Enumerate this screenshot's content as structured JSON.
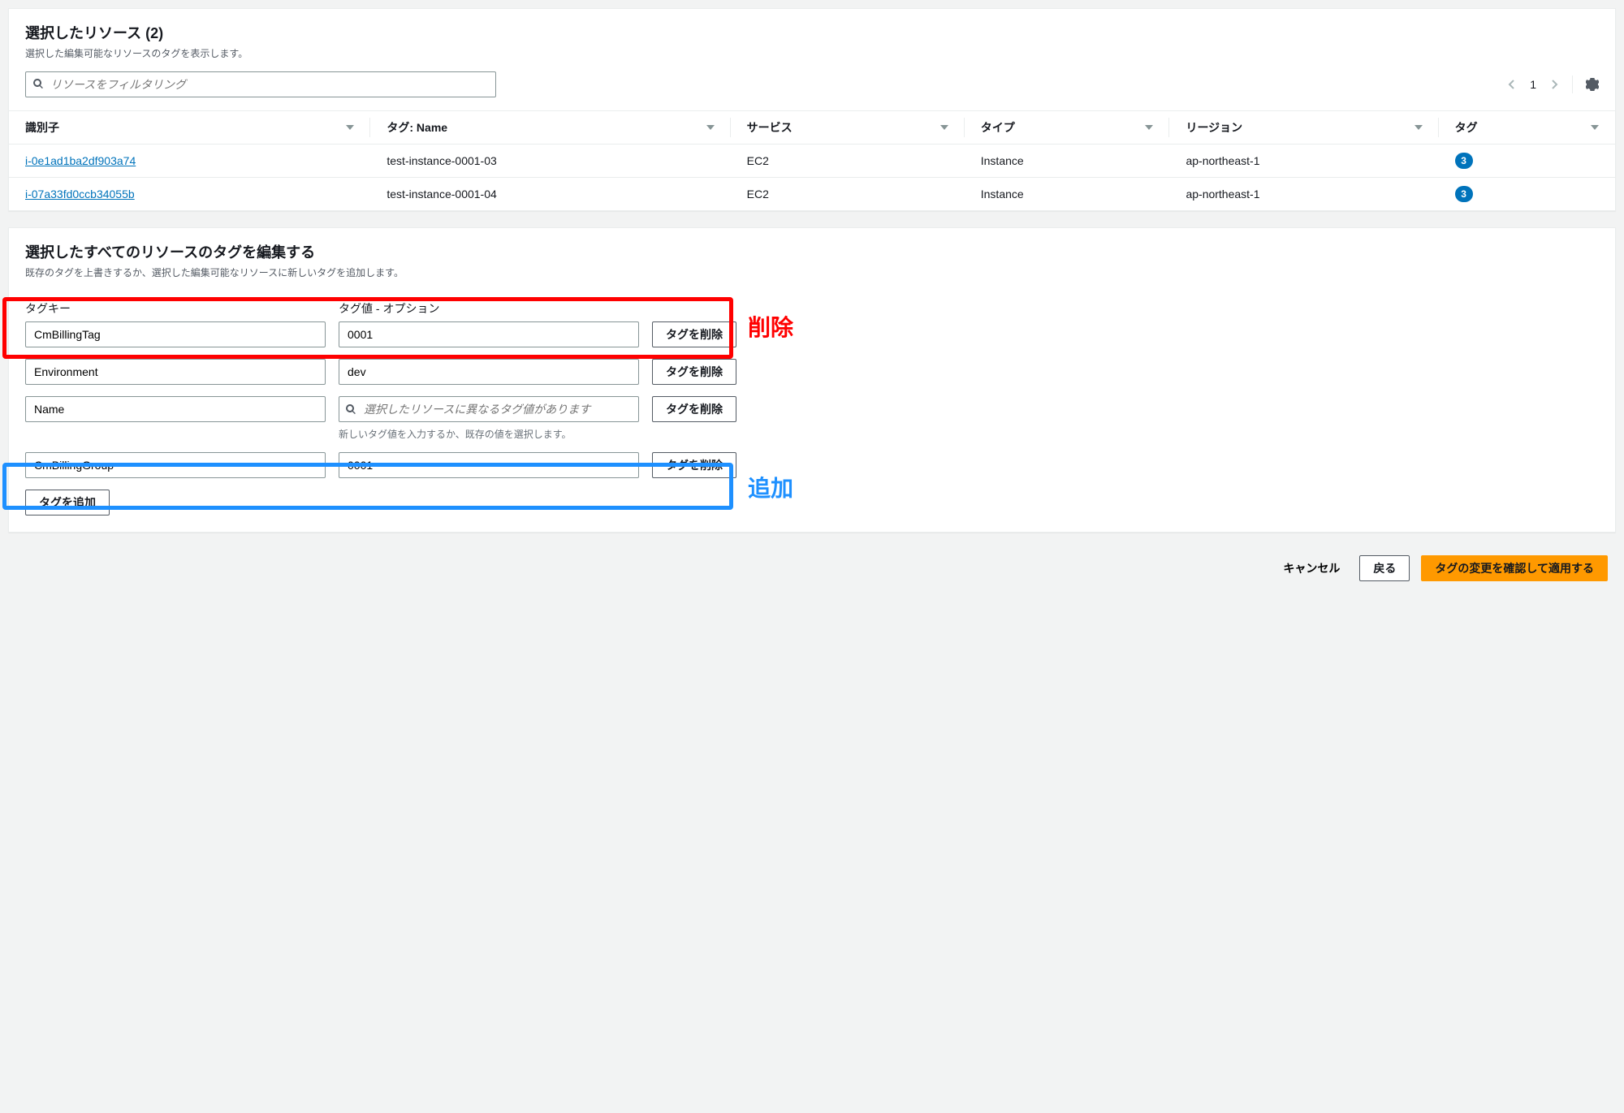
{
  "selectedResources": {
    "title": "選択したリソース (2)",
    "description": "選択した編集可能なリソースのタグを表示します。",
    "filterPlaceholder": "リソースをフィルタリング",
    "pager": {
      "page": "1"
    },
    "columns": {
      "identifier": "識別子",
      "tagName": "タグ: Name",
      "service": "サービス",
      "type": "タイプ",
      "region": "リージョン",
      "tag": "タグ"
    },
    "rows": [
      {
        "identifier": "i-0e1ad1ba2df903a74",
        "tagName": "test-instance-0001-03",
        "service": "EC2",
        "type": "Instance",
        "region": "ap-northeast-1",
        "tagCount": "3"
      },
      {
        "identifier": "i-07a33fd0ccb34055b",
        "tagName": "test-instance-0001-04",
        "service": "EC2",
        "type": "Instance",
        "region": "ap-northeast-1",
        "tagCount": "3"
      }
    ]
  },
  "editTags": {
    "title": "選択したすべてのリソースのタグを編集する",
    "description": "既存のタグを上書きするか、選択した編集可能なリソースに新しいタグを追加します。",
    "labels": {
      "tagKey": "タグキー",
      "tagValue": "タグ値 - オプション",
      "removeButton": "タグを削除",
      "addButton": "タグを追加",
      "nameValuePlaceholder": "選択したリソースに異なるタグ値があります",
      "nameHint": "新しいタグ値を入力するか、既存の値を選択します。"
    },
    "rows": [
      {
        "key": "CmBillingTag",
        "value": "0001",
        "highlight": "red"
      },
      {
        "key": "Environment",
        "value": "dev",
        "highlight": null
      },
      {
        "key": "Name",
        "value": "",
        "highlight": null,
        "isNameRow": true
      },
      {
        "key": "CmBillingGroup",
        "value": "0001",
        "highlight": "blue"
      }
    ],
    "annotations": {
      "delete": "削除",
      "add": "追加"
    }
  },
  "actions": {
    "cancel": "キャンセル",
    "back": "戻る",
    "apply": "タグの変更を確認して適用する"
  }
}
